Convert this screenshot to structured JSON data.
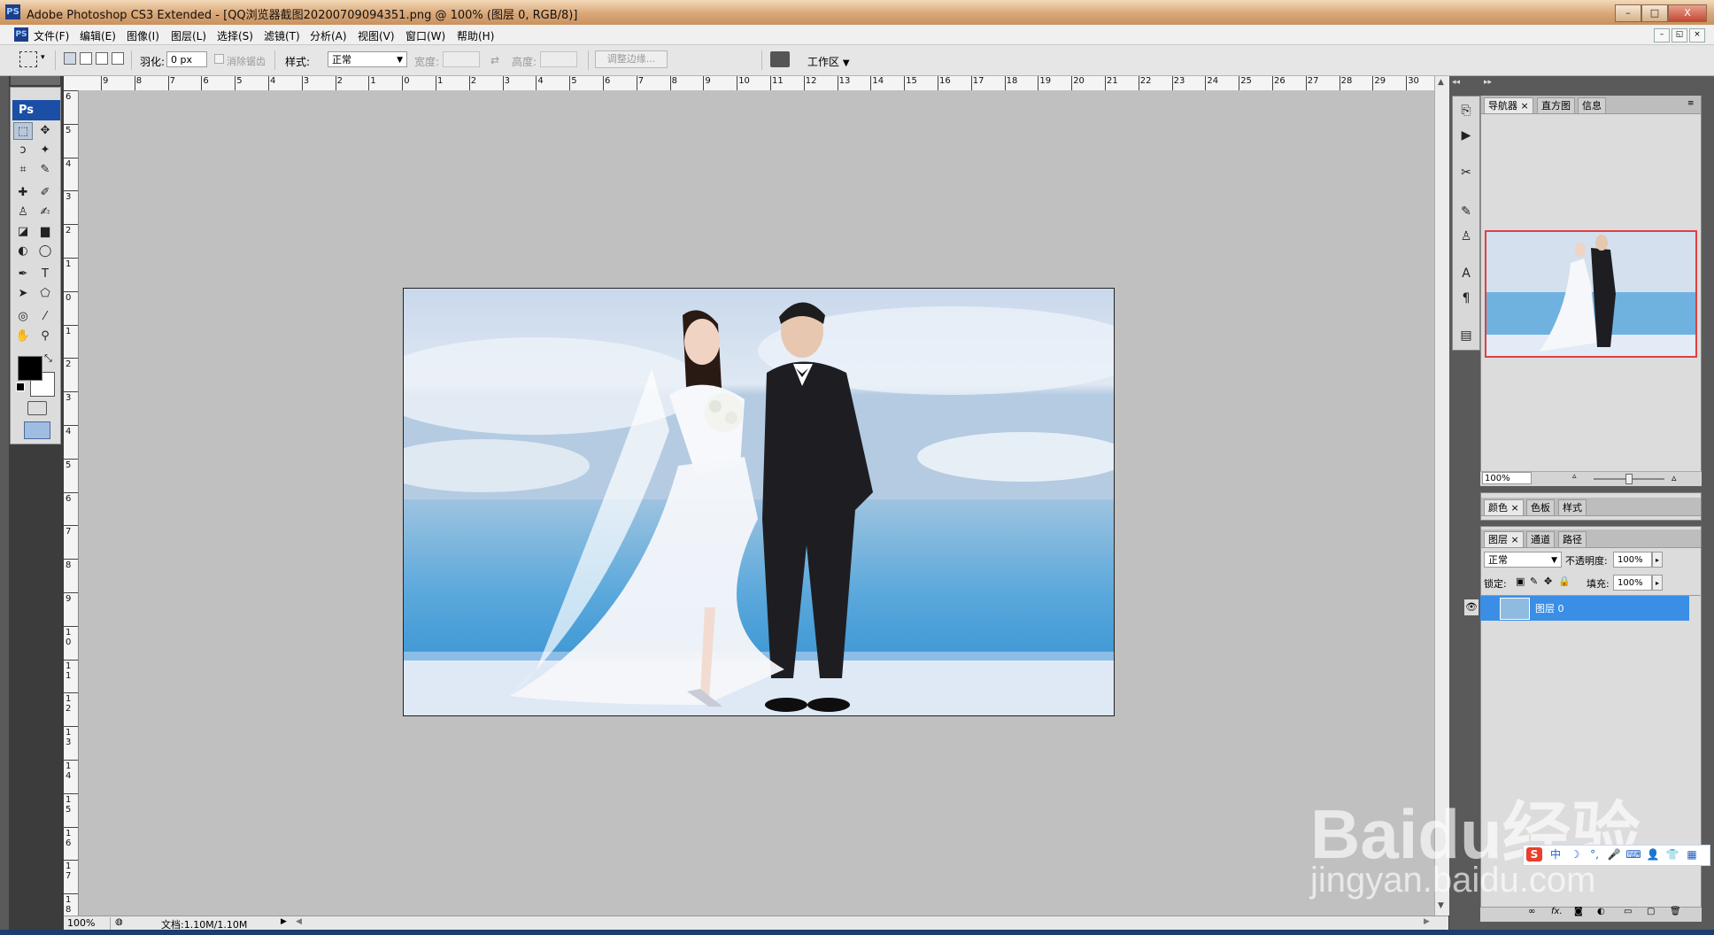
{
  "window": {
    "title": "Adobe Photoshop CS3 Extended - [QQ浏览器截图20200709094351.png @ 100% (图层 0, RGB/8)]",
    "app_logo": "PS",
    "controls": [
      "–",
      "□",
      "X"
    ]
  },
  "menubar": {
    "items": [
      "文件(F)",
      "编辑(E)",
      "图像(I)",
      "图层(L)",
      "选择(S)",
      "滤镜(T)",
      "分析(A)",
      "视图(V)",
      "窗口(W)",
      "帮助(H)"
    ],
    "doc_controls": [
      "–",
      "◱",
      "×"
    ]
  },
  "options_bar": {
    "feather_label": "羽化:",
    "feather_value": "0 px",
    "antialias_label": "消除锯齿",
    "style_label": "样式:",
    "style_value": "正常",
    "width_label": "宽度:",
    "height_label": "高度:",
    "refine_edge_label": "调整边缘...",
    "workspace_label": "工作区"
  },
  "toolbox": {
    "logo": "Ps"
  },
  "rulers": {
    "top": [
      "9",
      "8",
      "7",
      "6",
      "5",
      "4",
      "3",
      "2",
      "1",
      "0",
      "1",
      "2",
      "3",
      "4",
      "5",
      "6",
      "7",
      "8",
      "9",
      "10",
      "11",
      "12",
      "13",
      "14",
      "15",
      "16",
      "17",
      "18",
      "19",
      "20",
      "21",
      "22",
      "23",
      "24",
      "25",
      "26",
      "27",
      "28",
      "29",
      "30"
    ],
    "left": [
      "6",
      "5",
      "4",
      "3",
      "2",
      "1",
      "0",
      "1",
      "2",
      "3",
      "4",
      "5",
      "6",
      "7",
      "8",
      "9",
      "1 0",
      "1 1",
      "1 2",
      "1 3",
      "1 4",
      "1 5",
      "1 6",
      "1 7",
      "1 8"
    ]
  },
  "status_bar": {
    "zoom": "100%",
    "doc_info": "文档:1.10M/1.10M"
  },
  "navigator_panel": {
    "tabs": [
      "导航器",
      "直方图",
      "信息"
    ],
    "zoom": "100%"
  },
  "color_panel": {
    "tabs": [
      "颜色",
      "色板",
      "样式"
    ]
  },
  "layers_panel": {
    "tabs": [
      "图层",
      "通道",
      "路径"
    ],
    "blend_mode": "正常",
    "opacity_label": "不透明度:",
    "opacity_value": "100%",
    "lock_label": "锁定:",
    "fill_label": "填充:",
    "fill_value": "100%",
    "layers": [
      {
        "name": "图层 0",
        "selected": true,
        "visible": true
      }
    ]
  },
  "watermark": {
    "logo_text": "Baidu经验",
    "url": "jingyan.baidu.com"
  },
  "ime_toolbar": {
    "items": [
      "S",
      "中"
    ]
  },
  "colors": {
    "title_gradient": "#d9a777",
    "canvas_bg": "#c0c0c0",
    "selection_blue": "#3a8ee6",
    "nav_frame": "#e04040",
    "ps_badge": "#1b4fa6"
  }
}
